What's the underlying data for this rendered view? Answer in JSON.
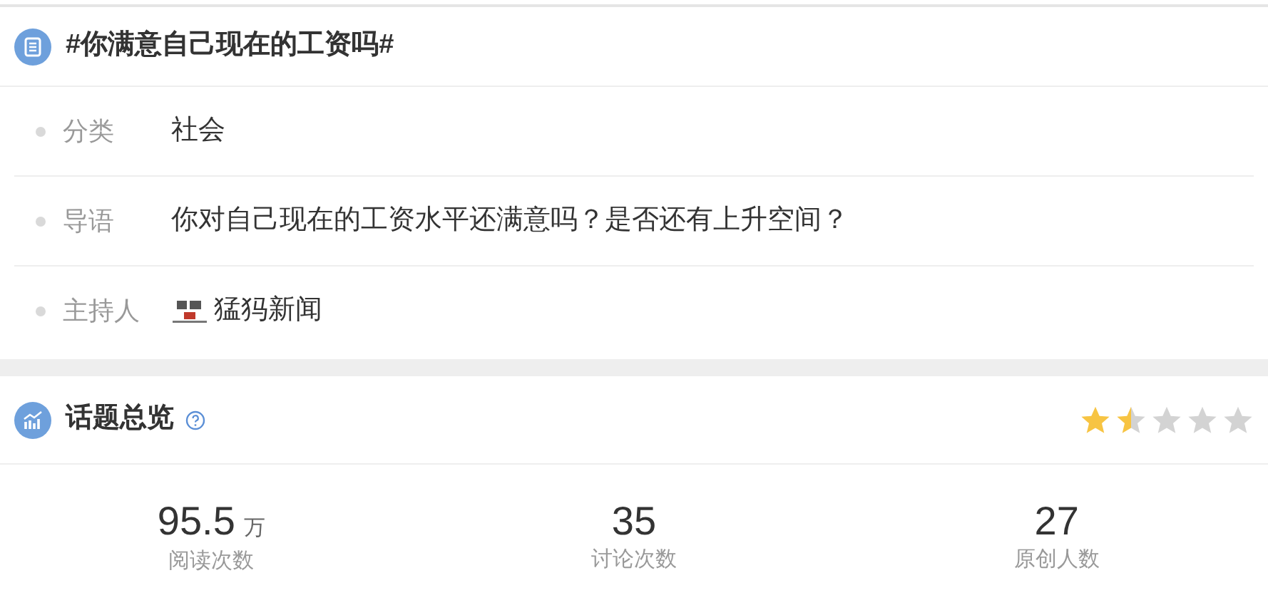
{
  "topic": {
    "title": "#你满意自己现在的工资吗#",
    "rows": [
      {
        "kind": "text",
        "label": "分类",
        "value": "社会"
      },
      {
        "kind": "text",
        "label": "导语",
        "value": "你对自己现在的工资水平还满意吗？是否还有上升空间？"
      },
      {
        "kind": "host",
        "label": "主持人",
        "value": "猛犸新闻"
      }
    ]
  },
  "overview": {
    "title": "话题总览",
    "stars": 1.5,
    "stats": [
      {
        "value": "95.5",
        "unit": "万",
        "label": "阅读次数"
      },
      {
        "value": "35",
        "label": "讨论次数"
      },
      {
        "value": "27",
        "label": "原创人数"
      }
    ]
  }
}
